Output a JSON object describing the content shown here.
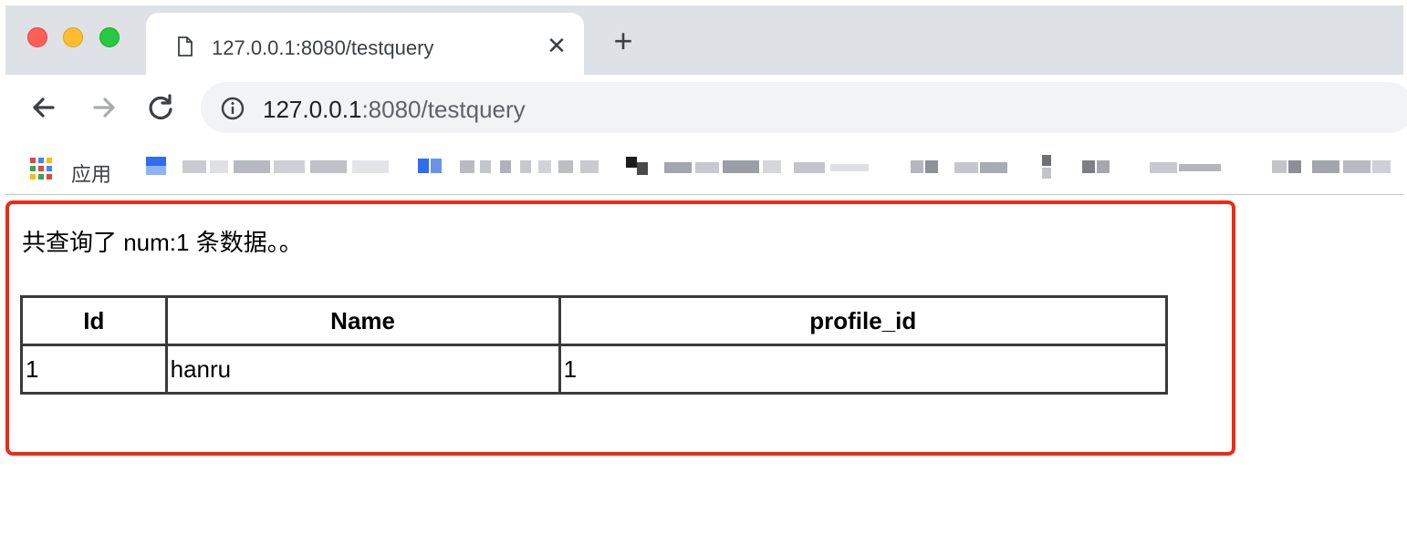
{
  "browser": {
    "tab_title": "127.0.0.1:8080/testquery",
    "tab_close_glyph": "✕",
    "new_tab_glyph": "+",
    "url_host": "127.0.0.1",
    "url_rest": ":8080/testquery",
    "apps_label": "应用"
  },
  "page": {
    "summary": "共查询了 num:1 条数据。。",
    "table": {
      "headers": [
        "Id",
        "Name",
        "profile_id"
      ],
      "rows": [
        [
          "1",
          "hanru",
          "1"
        ]
      ]
    }
  },
  "colors": {
    "highlight_border": "#ee2a15",
    "tabstrip": "#dee1e6",
    "omnibox": "#f1f3f4"
  },
  "icons": [
    "document-icon",
    "close-icon",
    "plus-icon",
    "back-arrow-icon",
    "forward-arrow-icon",
    "reload-icon",
    "info-icon",
    "apps-grid-icon"
  ]
}
